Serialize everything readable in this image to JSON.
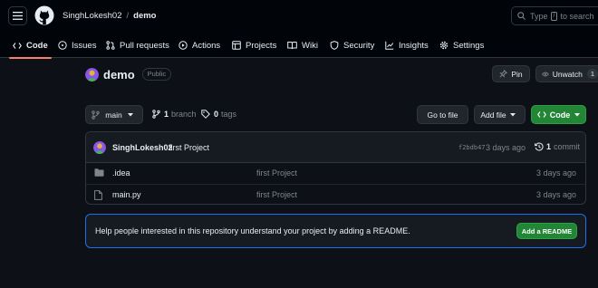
{
  "header": {
    "owner": "SinghLokesh02",
    "separator": "/",
    "repo": "demo",
    "search_prefix": "Type",
    "search_key": "/",
    "search_suffix": "to search"
  },
  "tabs": [
    {
      "label": "Code",
      "icon": "code-icon",
      "active": true
    },
    {
      "label": "Issues",
      "icon": "issue-icon"
    },
    {
      "label": "Pull requests",
      "icon": "pull-request-icon"
    },
    {
      "label": "Actions",
      "icon": "play-icon"
    },
    {
      "label": "Projects",
      "icon": "table-icon"
    },
    {
      "label": "Wiki",
      "icon": "book-icon"
    },
    {
      "label": "Security",
      "icon": "shield-icon"
    },
    {
      "label": "Insights",
      "icon": "graph-icon"
    },
    {
      "label": "Settings",
      "icon": "gear-icon"
    }
  ],
  "repo": {
    "name": "demo",
    "visibility": "Public",
    "pin_label": "Pin",
    "unwatch_label": "Unwatch",
    "watch_count": "1"
  },
  "toolbar": {
    "branch": "main",
    "branch_count": "1",
    "branch_label": "branch",
    "tag_count": "0",
    "tag_label": "tags",
    "go_to_file": "Go to file",
    "add_file": "Add file",
    "code": "Code"
  },
  "latest_commit": {
    "author": "SinghLokesh02",
    "message": "first Project",
    "hash": "f2bdb47",
    "age": "3 days ago",
    "count": "1",
    "count_label": "commit"
  },
  "files": [
    {
      "name": ".idea",
      "type": "folder",
      "commit": "first Project",
      "age": "3 days ago"
    },
    {
      "name": "main.py",
      "type": "file",
      "commit": "first Project",
      "age": "3 days ago"
    }
  ],
  "readme": {
    "message": "Help people interested in this repository understand your project by adding a README.",
    "button": "Add a README"
  },
  "colors": {
    "background": "#0d1117",
    "header": "#010409",
    "accent_green": "#238636",
    "tab_underline": "#f78166",
    "readme_border": "#1f6feb"
  }
}
